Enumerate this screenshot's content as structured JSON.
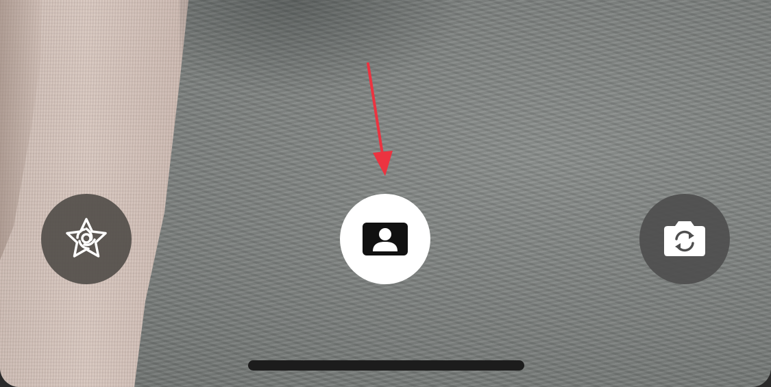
{
  "screen": {
    "description_colors": {
      "background_gray": "#7f8381",
      "fabric_beige": "#d3c2ba",
      "arrow_red": "#ec3340",
      "button_dark": "#524e4a",
      "button_light": "#ffffff"
    }
  },
  "controls": {
    "effects_button": {
      "icon": "star-effects-icon"
    },
    "shutter_button": {
      "icon": "person-card-icon"
    },
    "flip_camera_button": {
      "icon": "camera-flip-icon"
    }
  },
  "annotation": {
    "arrow": {
      "color": "#ec3340",
      "points_to": "shutter_button"
    }
  }
}
